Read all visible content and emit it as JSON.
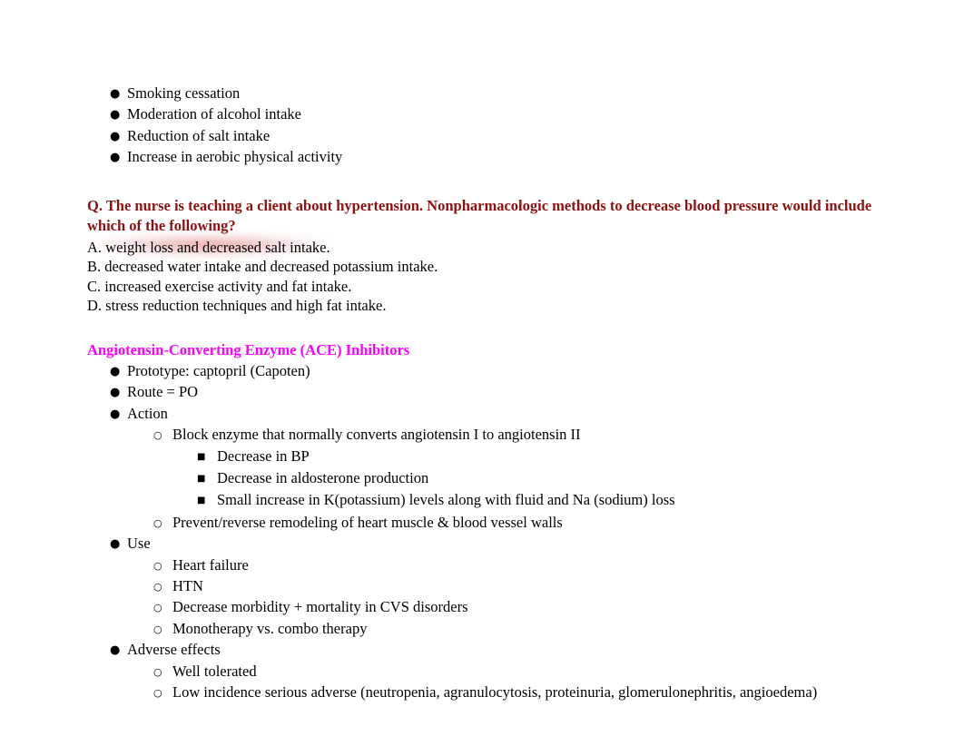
{
  "document": {
    "top_list": {
      "bullet_glyph": "●",
      "items": [
        "Smoking cessation",
        "Moderation of alcohol intake",
        "Reduction of salt intake",
        "Increase in aerobic physical activity"
      ]
    },
    "question_block": {
      "question_color": "#8e1111",
      "highlight_color": "#e28686",
      "question_line_1": "Q. The nurse is teaching a client about hypertension. Nonpharmacologic methods to decrease blood pressure would include",
      "question_line_2": "which of the following?",
      "answers": [
        {
          "id": "A",
          "text": "A. weight loss and decreased salt intake.",
          "highlighted": true
        },
        {
          "id": "B",
          "text": "B. decreased water intake and decreased potassium intake.",
          "highlighted": false
        },
        {
          "id": "C",
          "text": "C. increased exercise activity and fat intake.",
          "highlighted": false
        },
        {
          "id": "D",
          "text": "D. stress reduction techniques and high fat intake.",
          "highlighted": false
        }
      ]
    },
    "ace_section": {
      "heading": "Angiotensin-Converting Enzyme (ACE) Inhibitors",
      "heading_color": "#ff00ff",
      "bullet_glyph_level1": "●",
      "bullet_glyph_level2": "○",
      "bullet_glyph_level3": "■",
      "rows": [
        {
          "level": 1,
          "text": "Prototype: captopril (Capoten)"
        },
        {
          "level": 1,
          "text": "Route = PO"
        },
        {
          "level": 1,
          "text": "Action"
        },
        {
          "level": 2,
          "text": "Block enzyme that normally converts angiotensin I to angiotensin II"
        },
        {
          "level": 3,
          "text": "Decrease in BP"
        },
        {
          "level": 3,
          "text": "Decrease in aldosterone production"
        },
        {
          "level": 3,
          "text": "Small increase in K(potassium) levels along with fluid and Na (sodium) loss"
        },
        {
          "level": 2,
          "text": "Prevent/reverse remodeling of heart muscle & blood vessel walls"
        },
        {
          "level": 1,
          "text": "Use"
        },
        {
          "level": 2,
          "text": "Heart failure"
        },
        {
          "level": 2,
          "text": "HTN"
        },
        {
          "level": 2,
          "text": "Decrease morbidity + mortality in CVS disorders"
        },
        {
          "level": 2,
          "text": "Monotherapy vs. combo therapy"
        },
        {
          "level": 1,
          "text": "Adverse effects"
        },
        {
          "level": 2,
          "text": "Well tolerated"
        },
        {
          "level": 2,
          "text": "Low incidence serious adverse (neutropenia, agranulocytosis, proteinuria, glomerulonephritis, angioedema)"
        }
      ]
    }
  }
}
